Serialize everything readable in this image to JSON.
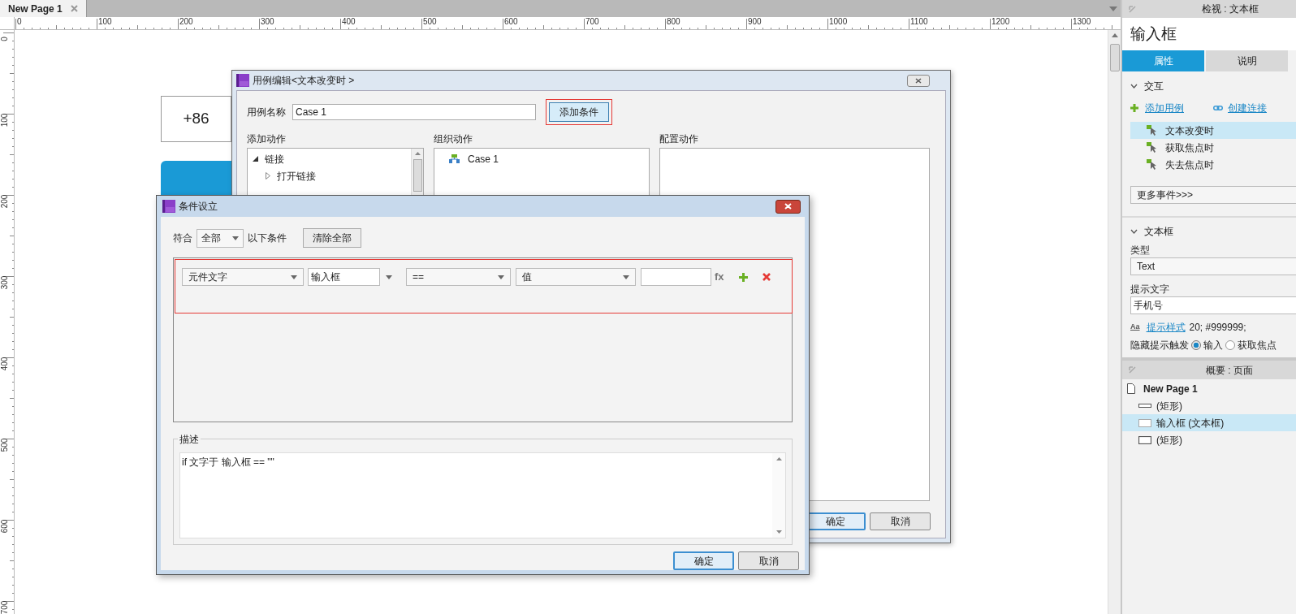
{
  "document_tab": {
    "label": "New Page 1"
  },
  "rulers": {
    "horizontal": [
      "0",
      "100",
      "200",
      "300",
      "400",
      "500",
      "600",
      "700",
      "800",
      "900",
      "1000",
      "1100",
      "1200",
      "1300"
    ],
    "vertical": [
      "0",
      "100",
      "200",
      "300",
      "400",
      "500",
      "600",
      "700"
    ]
  },
  "canvas": {
    "widgets": [
      {
        "kind": "text_box",
        "text": "+86"
      },
      {
        "kind": "button_block"
      }
    ]
  },
  "case_editor": {
    "title": "用例编辑<文本改变时 >",
    "name_label": "用例名称",
    "name_value": "Case 1",
    "add_condition_button": "添加条件",
    "columns": [
      "添加动作",
      "组织动作",
      "配置动作"
    ],
    "actions_tree": [
      {
        "label": "链接",
        "expanded": true,
        "children": [
          {
            "label": "打开链接",
            "expanded": false
          }
        ]
      }
    ],
    "organized": [
      {
        "label": "Case 1"
      }
    ],
    "buttons": [
      {
        "label": "确定",
        "default": true
      },
      {
        "label": "取消",
        "default": false
      }
    ]
  },
  "condition_dialog": {
    "title": "条件设立",
    "match_label": "符合",
    "match_value": "全部",
    "match_suffix": "以下条件",
    "clear_button": "清除全部",
    "conditions": [
      {
        "source": "元件文字",
        "widget": "输入框",
        "operator": "==",
        "value_type": "值",
        "function_button": "fx"
      }
    ],
    "description_label": "描述",
    "description": "if 文字于 输入框 == \"\"",
    "buttons": [
      {
        "label": "确定",
        "default": true
      },
      {
        "label": "取消",
        "default": false
      }
    ]
  },
  "inspector": {
    "header": "检视 : 文本框",
    "title": "输入框",
    "tabs": [
      {
        "label": "属性",
        "selected": true
      },
      {
        "label": "说明",
        "selected": false
      }
    ],
    "interaction": {
      "title": "交互",
      "expanded": true,
      "add_case": "添加用例",
      "create_link": "创建连接",
      "events": [
        {
          "label": "文本改变时",
          "selected": true
        },
        {
          "label": "获取焦点时",
          "selected": false
        },
        {
          "label": "失去焦点时",
          "selected": false
        }
      ],
      "more_events": "更多事件>>>"
    },
    "text_box": {
      "title": "文本框",
      "expanded": true,
      "type_label": "类型",
      "type_value": "Text",
      "hint_label": "提示文字",
      "hint_value": "手机号",
      "hint_style_icon": "Aa",
      "hint_style_link": "提示样式",
      "hint_style_value": "20; #999999;",
      "hide_label": "隐藏提示触发",
      "hide_options": [
        {
          "label": "输入",
          "selected": true
        },
        {
          "label": "获取焦点",
          "selected": false
        }
      ]
    }
  },
  "outline": {
    "header": "概要 : 页面",
    "page": "New Page 1",
    "items": [
      {
        "kind": "line",
        "label": "(矩形)",
        "selected": false
      },
      {
        "kind": "textbox",
        "label": "输入框 (文本框)",
        "selected": true
      },
      {
        "kind": "rect",
        "label": "(矩形)",
        "selected": false
      }
    ]
  }
}
